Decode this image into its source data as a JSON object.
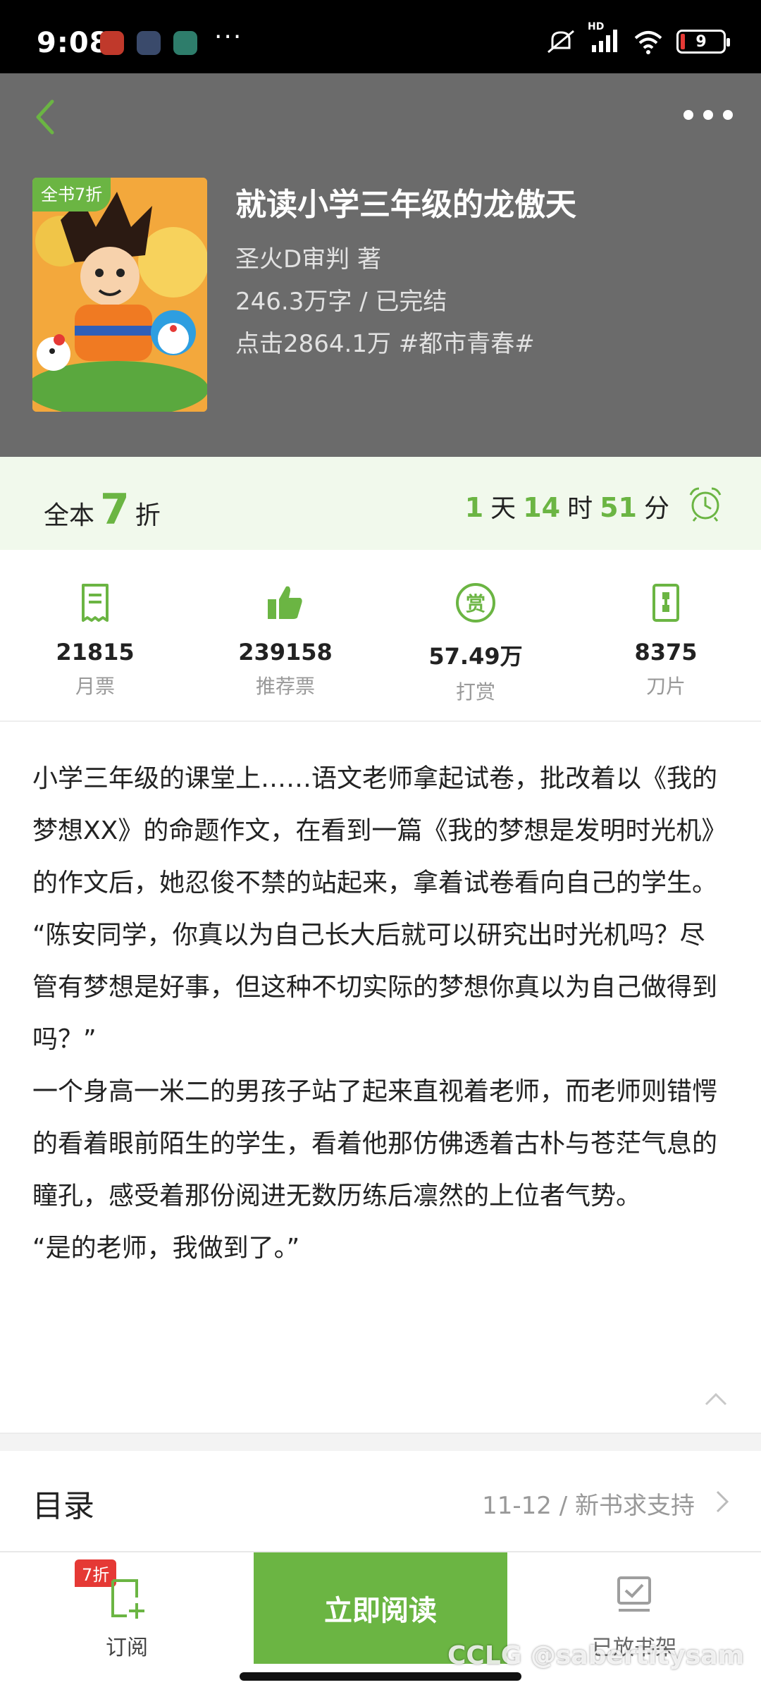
{
  "status_bar": {
    "time": "9:08",
    "more": "···",
    "network": "HD",
    "battery": "9"
  },
  "header": {
    "cover_badge": "全书7折",
    "title": "就读小学三年级的龙傲天",
    "author": "圣火D审判  著",
    "words_status": "246.3万字 / 已完结",
    "clicks_tag": "点击2864.1万  #都市青春#"
  },
  "discount": {
    "prefix": "全本",
    "value": "7",
    "suffix": "折",
    "days": "1",
    "days_unit": "天",
    "hours": "14",
    "hours_unit": "时",
    "minutes": "51",
    "minutes_unit": "分"
  },
  "stats": [
    {
      "value": "21815",
      "label": "月票",
      "icon": "monthly-ticket-icon"
    },
    {
      "value": "239158",
      "label": "推荐票",
      "icon": "thumbs-up-icon"
    },
    {
      "value": "57.49万",
      "label": "打赏",
      "icon": "reward-icon"
    },
    {
      "value": "8375",
      "label": "刀片",
      "icon": "blade-icon"
    }
  ],
  "intro": [
    "小学三年级的课堂上……语文老师拿起试卷，批改着以《我的梦想XX》的命题作文，在看到一篇《我的梦想是发明时光机》的作文后，她忍俊不禁的站起来，拿着试卷看向自己的学生。",
    "“陈安同学，你真以为自己长大后就可以研究出时光机吗？尽管有梦想是好事，但这种不切实际的梦想你真以为自己做得到吗？”",
    "一个身高一米二的男孩子站了起来直视着老师，而老师则错愕的看着眼前陌生的学生，看着他那仿佛透着古朴与苍茫气息的瞳孔，感受着那份阅进无数历练后凛然的上位者气势。",
    "“是的老师，我做到了。”"
  ],
  "catalog": {
    "title": "目录",
    "status": "11-12 / 新书求支持"
  },
  "bottom_bar": {
    "subscribe_badge": "7折",
    "subscribe_label": "订阅",
    "read_label": "立即阅读",
    "shelf_label": "已放书架"
  },
  "watermark": "CCLG @sabertitysam",
  "colors": {
    "accent": "#6bb543",
    "header_bg": "#6b6b6b",
    "discount_bg": "#f1f9ec",
    "badge_red": "#e53935"
  }
}
